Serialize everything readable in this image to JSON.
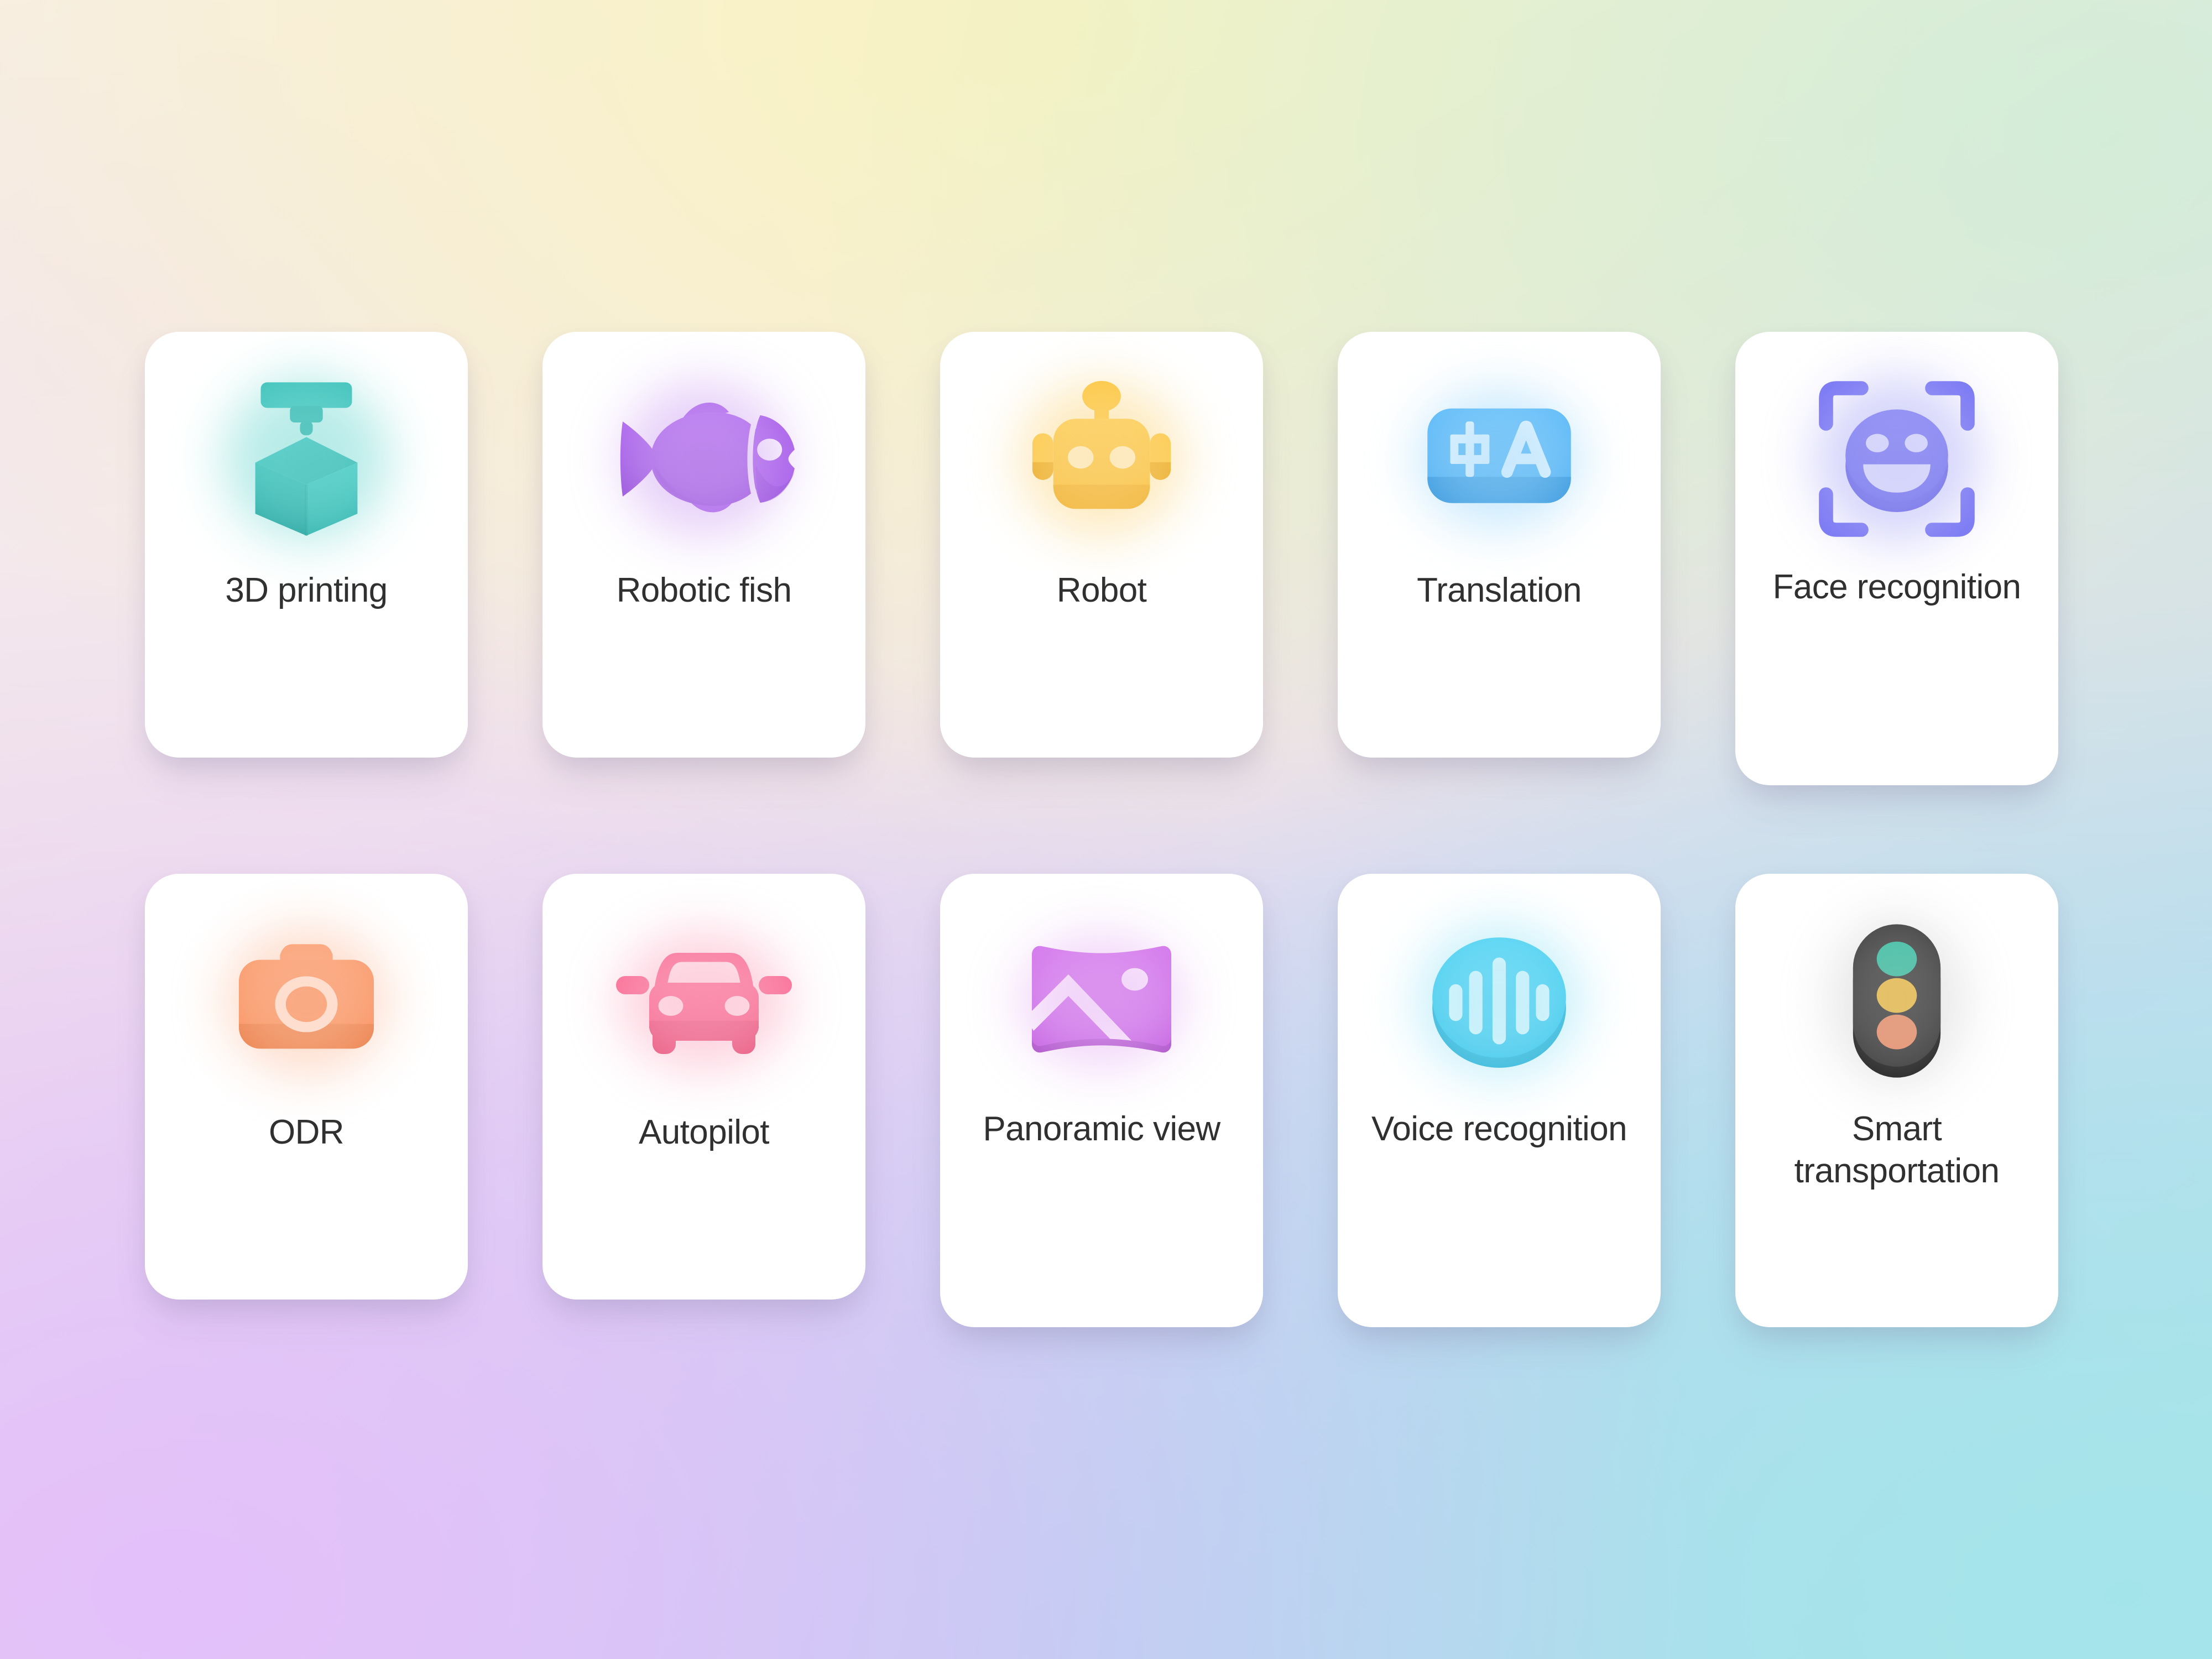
{
  "background": {
    "gradient_stops": [
      "#f9f5e6",
      "#f3e5f0",
      "#cfeed6",
      "#e4befa",
      "#b0cdf0",
      "#a2e5ea"
    ]
  },
  "grid": {
    "columns": 5,
    "rows": 2
  },
  "cards": [
    {
      "id": "3d-printing",
      "label": "3D printing",
      "icon": "3d-printer-cube-icon",
      "color": "#2bb5b0",
      "glow": "#7fdcd6"
    },
    {
      "id": "robotic-fish",
      "label": "Robotic fish",
      "icon": "fish-icon",
      "color": "#a259e6",
      "glow": "#d3a9f3"
    },
    {
      "id": "robot",
      "label": "Robot",
      "icon": "robot-head-icon",
      "color": "#fbc13c",
      "glow": "#fbd98a"
    },
    {
      "id": "translation",
      "label": "Translation",
      "icon": "translate-icon",
      "color": "#52b4f5",
      "glow": "#9fd8fb",
      "glyph_primary": "中",
      "glyph_secondary": "A"
    },
    {
      "id": "face-recognition",
      "label": "Face recognition",
      "icon": "face-scan-icon",
      "color": "#6f6ef0",
      "glow": "#b3b2f7"
    },
    {
      "id": "odr",
      "label": "ODR",
      "icon": "camera-icon",
      "color": "#f98c5c",
      "glow": "#fcc2a4"
    },
    {
      "id": "autopilot",
      "label": "Autopilot",
      "icon": "car-front-icon",
      "color": "#f7608c",
      "glow": "#fbadc4"
    },
    {
      "id": "panoramic-view",
      "label": "Panoramic view",
      "icon": "panorama-image-icon",
      "color": "#cd66e8",
      "glow": "#e7b4f4"
    },
    {
      "id": "voice-recognition",
      "label": "Voice recognition",
      "icon": "sound-wave-icon",
      "color": "#37c8ee",
      "glow": "#9ae4f7"
    },
    {
      "id": "smart-transportation",
      "label": "Smart transportation",
      "icon": "traffic-light-icon",
      "color": "#333333",
      "glow": "#c9c9c9",
      "light_green": "#32c8a8",
      "light_yellow": "#fcc63f",
      "light_red": "#fa9166"
    }
  ]
}
